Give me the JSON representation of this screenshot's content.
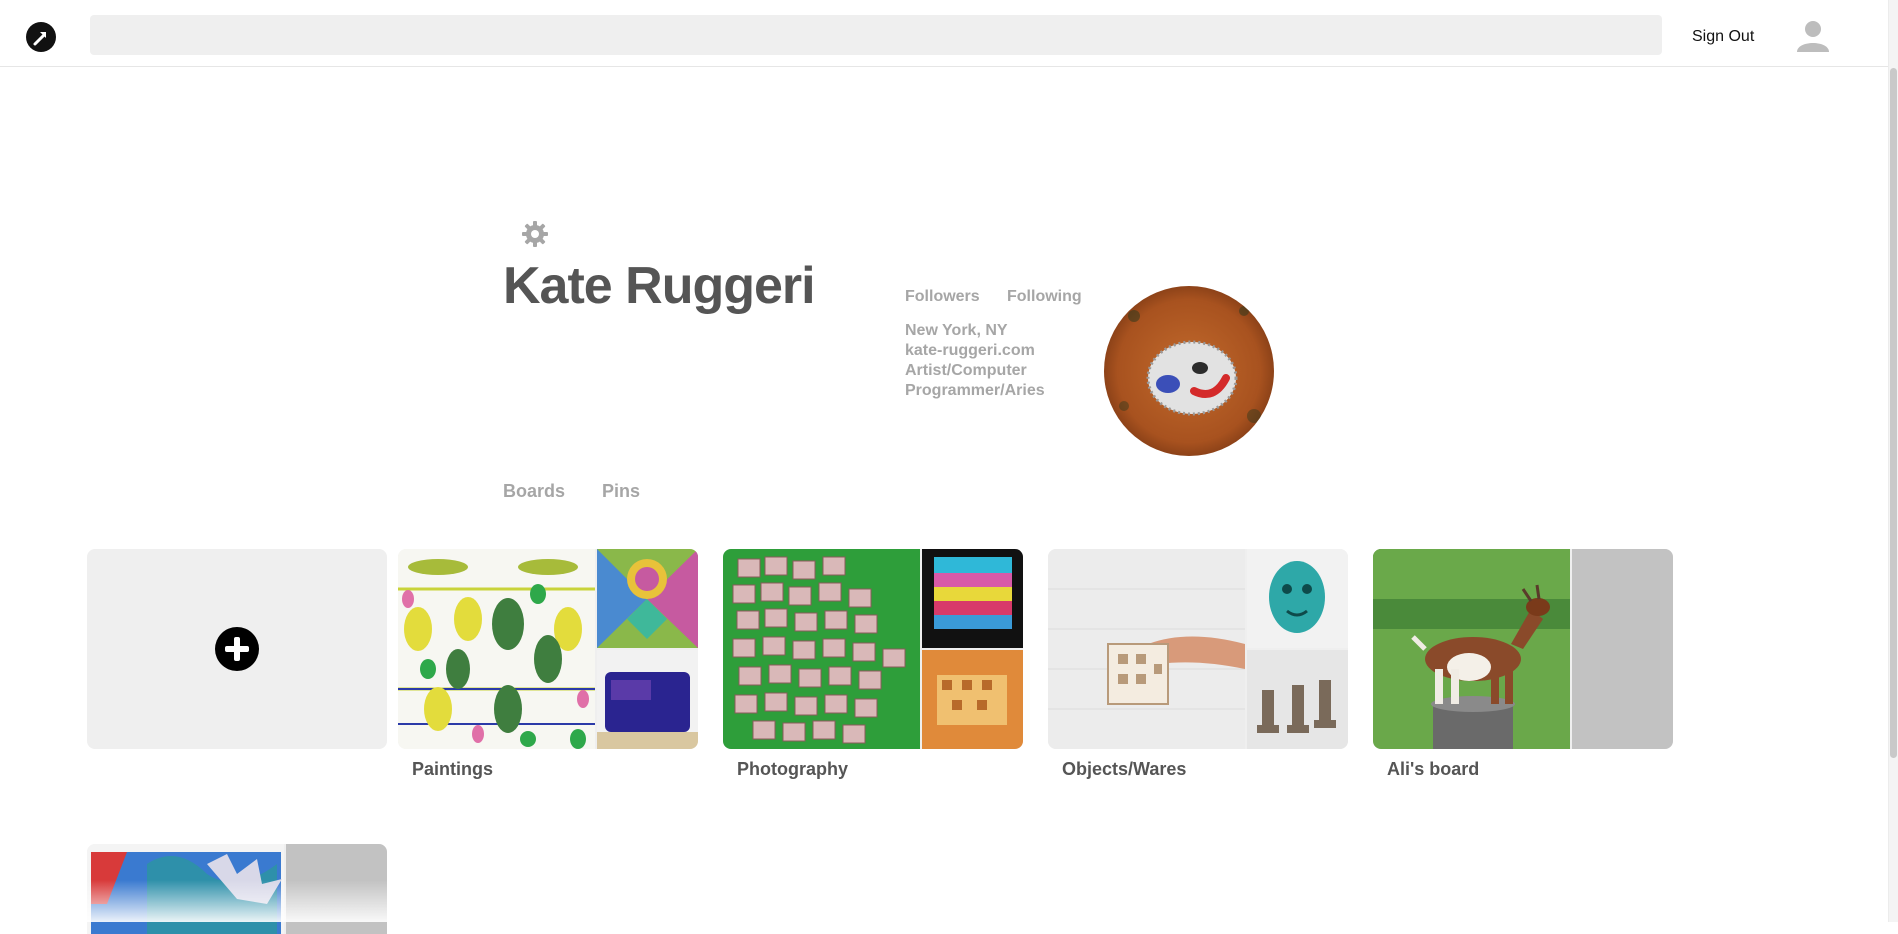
{
  "topbar": {
    "logo_icon": "pinterest-like-logo-icon",
    "search_placeholder": "",
    "sign_out_label": "Sign Out",
    "avatar_icon": "user-avatar-icon"
  },
  "profile": {
    "name": "Kate  Ruggeri",
    "settings_icon": "gear-icon",
    "followers_label": "Followers",
    "following_label": "Following",
    "location": "New York, NY",
    "website": "kate-ruggeri.com",
    "bio": "Artist/Computer Programmer/Aries"
  },
  "tabs": [
    {
      "label": "Boards"
    },
    {
      "label": "Pins"
    }
  ],
  "add_board_icon": "plus-circle-icon",
  "boards": [
    {
      "title": "Paintings"
    },
    {
      "title": "Photography"
    },
    {
      "title": "Objects/Wares"
    },
    {
      "title": "Ali's board"
    }
  ],
  "colors": {
    "accent": "#000000",
    "text_dark": "#555555",
    "text_muted": "#a6a6a6",
    "card_bg": "#efefef"
  }
}
